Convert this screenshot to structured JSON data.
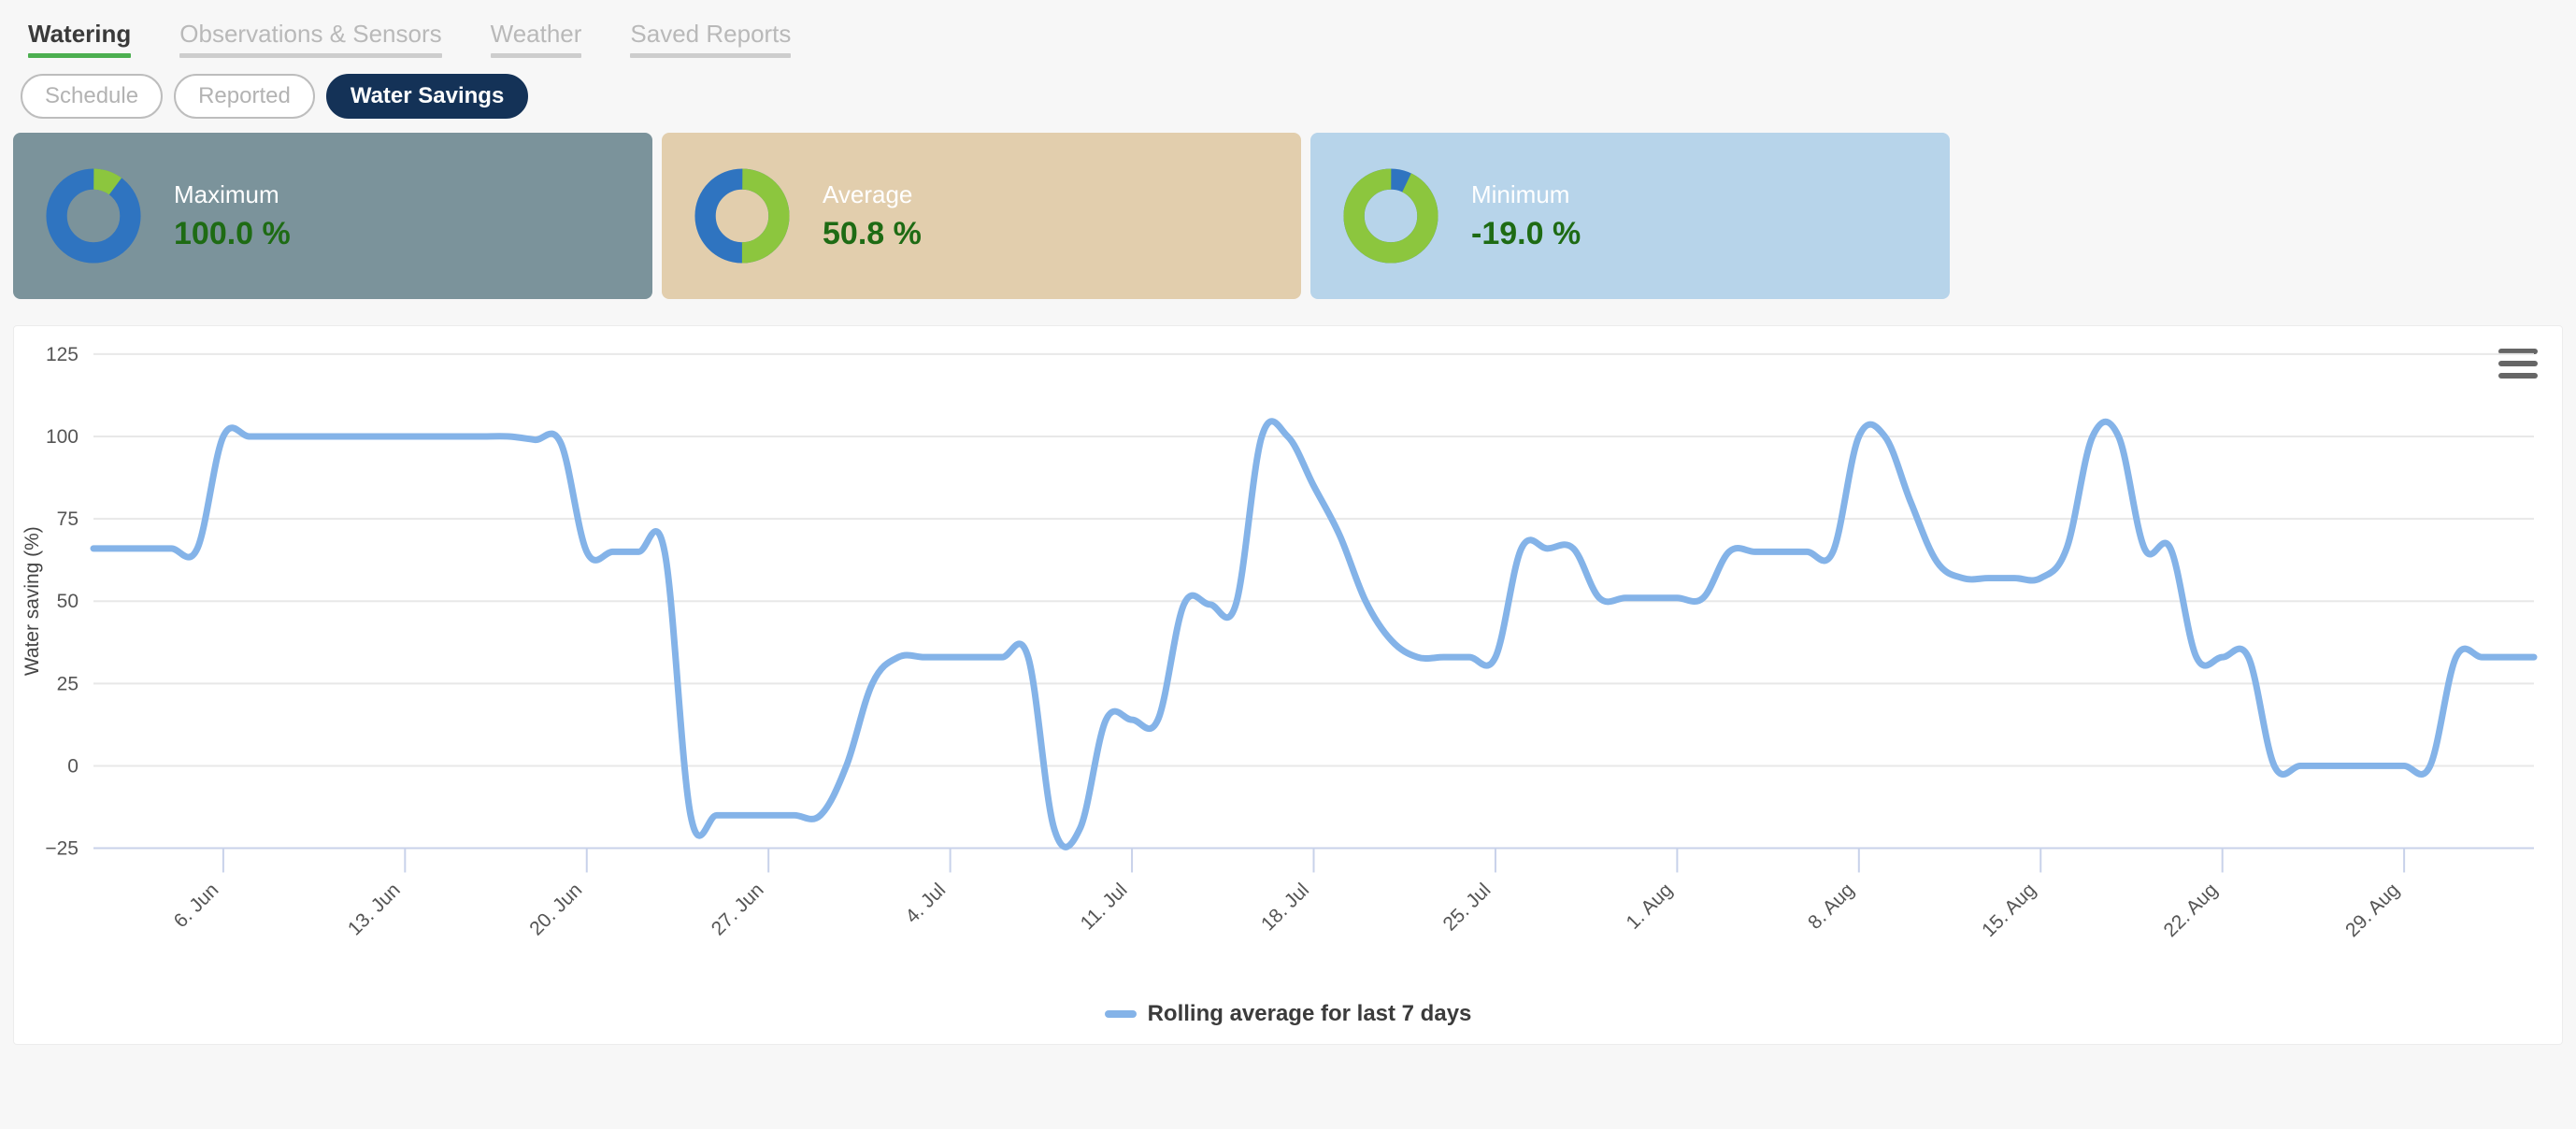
{
  "tabs": [
    {
      "label": "Watering",
      "active": true
    },
    {
      "label": "Observations & Sensors",
      "active": false
    },
    {
      "label": "Weather",
      "active": false
    },
    {
      "label": "Saved Reports",
      "active": false
    }
  ],
  "pills": [
    {
      "label": "Schedule",
      "selected": false
    },
    {
      "label": "Reported",
      "selected": false
    },
    {
      "label": "Water Savings",
      "selected": true
    }
  ],
  "cards": [
    {
      "label": "Maximum",
      "value": "100.0 %",
      "bg": "#7b939b",
      "blue_fraction": 0.9,
      "green_fraction": 0.1
    },
    {
      "label": "Average",
      "value": "50.8 %",
      "bg": "#e2cead",
      "blue_fraction": 0.5,
      "green_fraction": 0.5
    },
    {
      "label": "Minimum",
      "value": "-19.0 %",
      "bg": "#b7d4ea",
      "blue_fraction": 0.07,
      "green_fraction": 0.93
    }
  ],
  "colors": {
    "donut_blue": "#2f74c0",
    "donut_green": "#8cc63e",
    "series_blue": "#84b3e8",
    "value_green": "#1e6b14",
    "tab_accent": "#4caf50",
    "pill_selected": "#143257"
  },
  "menu": {
    "icon": "hamburger-icon"
  },
  "legend": {
    "label": "Rolling average for last 7 days"
  },
  "chart_data": {
    "type": "line",
    "title": "",
    "xlabel": "",
    "ylabel": "Water saving (%)",
    "ylim": [
      -25,
      125
    ],
    "yticks": [
      125,
      100,
      75,
      50,
      25,
      0,
      -25
    ],
    "grid": true,
    "legend_position": "bottom",
    "xticks": [
      "6. Jun",
      "13. Jun",
      "20. Jun",
      "27. Jun",
      "4. Jul",
      "11. Jul",
      "18. Jul",
      "25. Jul",
      "1. Aug",
      "8. Aug",
      "15. Aug",
      "22. Aug",
      "29. Aug"
    ],
    "x_start": "1. Jun",
    "x_end": "2. Sep",
    "series": [
      {
        "name": "Rolling average for last 7 days",
        "color": "#84b3e8",
        "x": [
          "1. Jun",
          "2. Jun",
          "3. Jun",
          "4. Jun",
          "5. Jun",
          "6. Jun",
          "7. Jun",
          "8. Jun",
          "9. Jun",
          "10. Jun",
          "11. Jun",
          "12. Jun",
          "13. Jun",
          "14. Jun",
          "15. Jun",
          "16. Jun",
          "17. Jun",
          "18. Jun",
          "19. Jun",
          "20. Jun",
          "21. Jun",
          "22. Jun",
          "23. Jun",
          "24. Jun",
          "25. Jun",
          "26. Jun",
          "27. Jun",
          "28. Jun",
          "29. Jun",
          "30. Jun",
          "1. Jul",
          "2. Jul",
          "3. Jul",
          "4. Jul",
          "5. Jul",
          "6. Jul",
          "7. Jul",
          "8. Jul",
          "9. Jul",
          "10. Jul",
          "11. Jul",
          "12. Jul",
          "13. Jul",
          "14. Jul",
          "15. Jul",
          "16. Jul",
          "17. Jul",
          "18. Jul",
          "19. Jul",
          "20. Jul",
          "21. Jul",
          "22. Jul",
          "23. Jul",
          "24. Jul",
          "25. Jul",
          "26. Jul",
          "27. Jul",
          "28. Jul",
          "29. Jul",
          "30. Jul",
          "31. Jul",
          "1. Aug",
          "2. Aug",
          "3. Aug",
          "4. Aug",
          "5. Aug",
          "6. Aug",
          "7. Aug",
          "8. Aug",
          "9. Aug",
          "10. Aug",
          "11. Aug",
          "12. Aug",
          "13. Aug",
          "14. Aug",
          "15. Aug",
          "16. Aug",
          "17. Aug",
          "18. Aug",
          "19. Aug",
          "20. Aug",
          "21. Aug",
          "22. Aug",
          "23. Aug",
          "24. Aug",
          "25. Aug",
          "26. Aug",
          "27. Aug",
          "28. Aug",
          "29. Aug",
          "30. Aug",
          "31. Aug",
          "1. Sep",
          "2. Sep"
        ],
        "values": [
          66,
          66,
          66,
          66,
          66,
          100,
          100,
          100,
          100,
          100,
          100,
          100,
          100,
          100,
          100,
          100,
          100,
          99,
          98,
          65,
          65,
          65,
          65,
          -15,
          -15,
          -15,
          -15,
          -15,
          -15,
          0,
          25,
          33,
          33,
          33,
          33,
          33,
          33,
          -19,
          -19,
          14,
          14,
          14,
          49,
          49,
          49,
          100,
          100,
          85,
          70,
          50,
          38,
          33,
          33,
          33,
          33,
          66,
          66,
          66,
          51,
          51,
          51,
          51,
          51,
          65,
          65,
          65,
          65,
          65,
          100,
          100,
          80,
          62,
          57,
          57,
          57,
          57,
          66,
          100,
          100,
          66,
          66,
          33,
          33,
          33,
          0,
          0,
          0,
          0,
          0,
          0,
          0,
          33,
          33,
          33,
          33
        ]
      }
    ]
  }
}
